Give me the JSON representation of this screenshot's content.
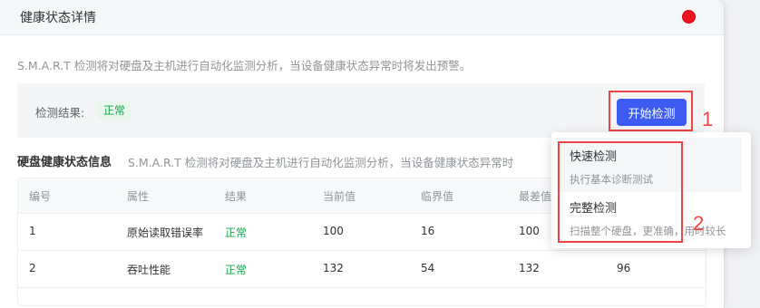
{
  "header": {
    "title": "健康状态详情"
  },
  "intro": "S.M.A.R.T 检测将对硬盘及主机进行自动化监测分析，当设备健康状态异常时将发出预警。",
  "result": {
    "label": "检测结果:",
    "status": "正常"
  },
  "start_button": "开始检测",
  "markers": {
    "one": "1",
    "two": "2"
  },
  "section": {
    "title": "硬盘健康状态信息",
    "desc": "S.M.A.R.T 检测将对硬盘及主机进行自动化监测分析，当设备健康状态异常时"
  },
  "table": {
    "columns": [
      "编号",
      "属性",
      "结果",
      "当前值",
      "临界值",
      "最差值"
    ],
    "rows": [
      [
        "1",
        "原始读取错误率",
        "正常",
        "100",
        "16",
        "100"
      ],
      [
        "2",
        "吞吐性能",
        "正常",
        "132",
        "54",
        "132",
        "96"
      ]
    ]
  },
  "dropdown": {
    "items": [
      {
        "title": "快速检测",
        "sub": "执行基本诊断测试"
      },
      {
        "title": "完整检测",
        "sub": "扫描整个硬盘，更准确，用时较长"
      }
    ]
  }
}
